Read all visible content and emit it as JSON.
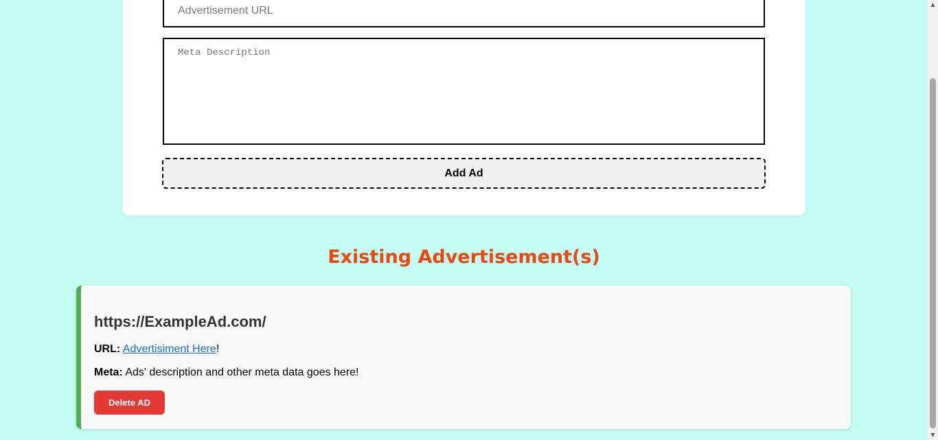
{
  "form": {
    "url_placeholder": "Advertisement URL",
    "meta_placeholder": "Meta Description",
    "add_label": "Add Ad"
  },
  "section": {
    "title": "Existing Advertisement(s)"
  },
  "ads": [
    {
      "title": "https://ExampleAd.com/",
      "url_label": "URL:",
      "url_text": "Advertisiment Here",
      "url_suffix": "!",
      "meta_label": "Meta:",
      "meta_text": "Ads' description and other meta data goes here!",
      "delete_label": "Delete AD"
    }
  ],
  "colors": {
    "page_background": "#c4fdf6",
    "heading": "#e8490f",
    "card_accent": "#4caf50",
    "delete_button": "#e53935",
    "link": "#1a6fc4"
  },
  "icons": {
    "scroll_up": "▲",
    "scroll_down": "▼"
  }
}
